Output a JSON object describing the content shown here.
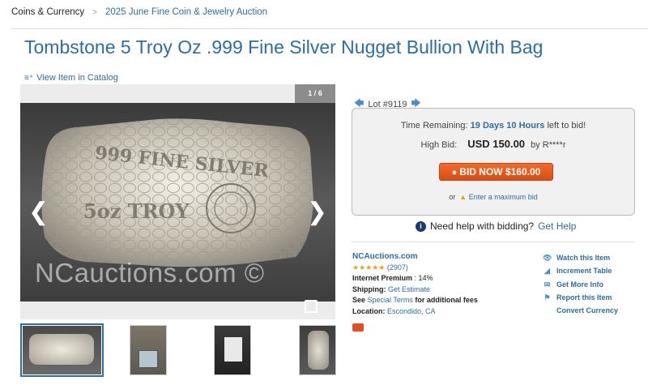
{
  "breadcrumb": {
    "root": "Coins & Currency",
    "sep": ">",
    "link": "2025 June Fine Coin & Jewelry Auction"
  },
  "title": "Tombstone 5 Troy Oz .999 Fine Silver Nugget Bullion With Bag",
  "catalog_link": "View Item in Catalog",
  "viewer": {
    "counter": "1 / 6",
    "watermark": "NCauctions.com ©",
    "engraving_line1": "999 FINE SILVER",
    "engraving_line2": "5oz TROY"
  },
  "lot": {
    "label": "Lot #9119"
  },
  "bid": {
    "time_label": "Time Remaining:",
    "time_value": "19 Days 10 Hours",
    "time_suffix": "left to bid!",
    "high_label": "High Bid:",
    "high_value": "USD 150.00",
    "high_by": "by R****r",
    "button": "BID NOW $160.00",
    "max_prefix": "or",
    "max_link": "Enter a maximum bid"
  },
  "help": {
    "text": "Need help with bidding?",
    "link": "Get Help"
  },
  "house": {
    "name": "NCAuctions.com",
    "stars": "★★★★★",
    "rating": "(2907)",
    "premium_label": "Internet Premium",
    "premium_value": ": 14%",
    "shipping_label": "Shipping:",
    "shipping_value": "Get Estimate",
    "terms_prefix": "See",
    "terms_link": "Special Terms",
    "terms_suffix": "for additional fees",
    "location_label": "Location:",
    "location_value": "Escondido, CA"
  },
  "side_links": {
    "watch": "Watch this Item",
    "increment": "Increment Table",
    "info": "Get More Info",
    "report": "Report this Item",
    "currency": "Convert Currency"
  },
  "colors": {
    "link": "#2d6e9e",
    "button": "#e8591f",
    "stars": "#e8a317"
  }
}
